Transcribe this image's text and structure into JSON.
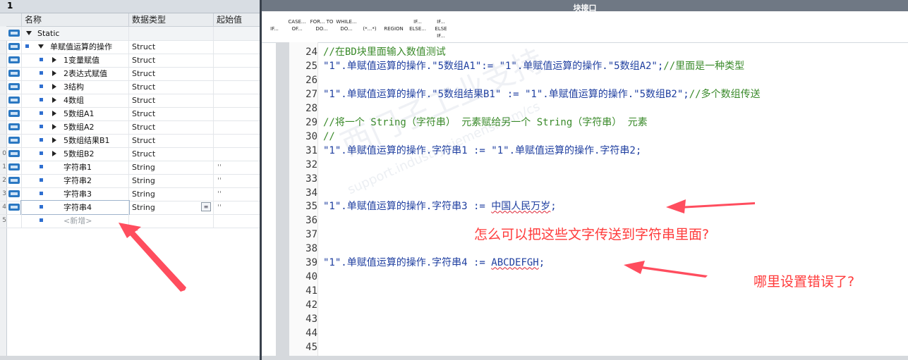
{
  "left_panel": {
    "title": "1",
    "headers": {
      "name": "名称",
      "type": "数据类型",
      "start": "起始值"
    },
    "rows": [
      {
        "num": "",
        "name": "Static",
        "type": "",
        "start": ""
      },
      {
        "num": "",
        "name": "单赋值运算的操作",
        "type": "Struct",
        "start": ""
      },
      {
        "num": "",
        "name": "1变量赋值",
        "type": "Struct",
        "start": ""
      },
      {
        "num": "",
        "name": "2表达式赋值",
        "type": "Struct",
        "start": ""
      },
      {
        "num": "",
        "name": "3结构",
        "type": "Struct",
        "start": ""
      },
      {
        "num": "",
        "name": "4数组",
        "type": "Struct",
        "start": ""
      },
      {
        "num": "",
        "name": "5数组A1",
        "type": "Struct",
        "start": ""
      },
      {
        "num": "",
        "name": "5数组A2",
        "type": "Struct",
        "start": ""
      },
      {
        "num": "",
        "name": "5数组结果B1",
        "type": "Struct",
        "start": ""
      },
      {
        "num": "0",
        "name": "5数组B2",
        "type": "Struct",
        "start": ""
      },
      {
        "num": "1",
        "name": "字符串1",
        "type": "String",
        "start": "''"
      },
      {
        "num": "2",
        "name": "字符串2",
        "type": "String",
        "start": "''"
      },
      {
        "num": "3",
        "name": "字符串3",
        "type": "String",
        "start": "''"
      },
      {
        "num": "4",
        "name": "字符串4",
        "type": "String",
        "start": "''"
      },
      {
        "num": "5",
        "name": "<新增>",
        "type": "",
        "start": ""
      }
    ]
  },
  "right_panel": {
    "title": "块接口",
    "toolbar": [
      {
        "label": "IF..."
      },
      {
        "label": "CASE... OF..."
      },
      {
        "label": "FOR... TO DO..."
      },
      {
        "label": "WHILE... DO..."
      },
      {
        "label": "(*...*)"
      },
      {
        "label": "REGION"
      },
      {
        "label": "IF... ELSE..."
      },
      {
        "label": "IF... ELSE IF..."
      }
    ],
    "code_lines": [
      {
        "n": "24",
        "text": "//在BD块里面输入数值测试",
        "comment": true
      },
      {
        "n": "25",
        "text": "\"1\".单赋值运算的操作.\"5数组A1\":= \"1\".单赋值运算的操作.\"5数组A2\";",
        "tail": "//里面是一种类型"
      },
      {
        "n": "26",
        "text": ""
      },
      {
        "n": "27",
        "text": "\"1\".单赋值运算的操作.\"5数组结果B1\" := \"1\".单赋值运算的操作.\"5数组B2\";",
        "tail": "//多个数组传送"
      },
      {
        "n": "28",
        "text": ""
      },
      {
        "n": "29",
        "text": "//将一个 String（字符串） 元素赋给另一个 String（字符串） 元素",
        "comment": true
      },
      {
        "n": "30",
        "text": "//",
        "comment": true
      },
      {
        "n": "31",
        "text": "\"1\".单赋值运算的操作.字符串1 := \"1\".单赋值运算的操作.字符串2;"
      },
      {
        "n": "32",
        "text": ""
      },
      {
        "n": "33",
        "text": ""
      },
      {
        "n": "34",
        "text": ""
      },
      {
        "n": "35",
        "text": "\"1\".单赋值运算的操作.字符串3 := ",
        "err": "中国人民万岁",
        "after": ";"
      },
      {
        "n": "36",
        "text": ""
      },
      {
        "n": "37",
        "text": ""
      },
      {
        "n": "38",
        "text": ""
      },
      {
        "n": "39",
        "text": "\"1\".单赋值运算的操作.字符串4 := ",
        "err": "ABCDEFGH",
        "after": ";"
      },
      {
        "n": "40",
        "text": ""
      },
      {
        "n": "41",
        "text": ""
      },
      {
        "n": "42",
        "text": ""
      },
      {
        "n": "43",
        "text": ""
      },
      {
        "n": "44",
        "text": ""
      },
      {
        "n": "45",
        "text": ""
      }
    ]
  },
  "annotations": {
    "question1": "怎么可以把这些文字传送到字符串里面?",
    "question2": "哪里设置错误了?",
    "arrow_color": "#ff4d5e"
  },
  "watermark": {
    "text1": "西门子工业支持",
    "text2": "support.industry.siemens.com/cs"
  }
}
